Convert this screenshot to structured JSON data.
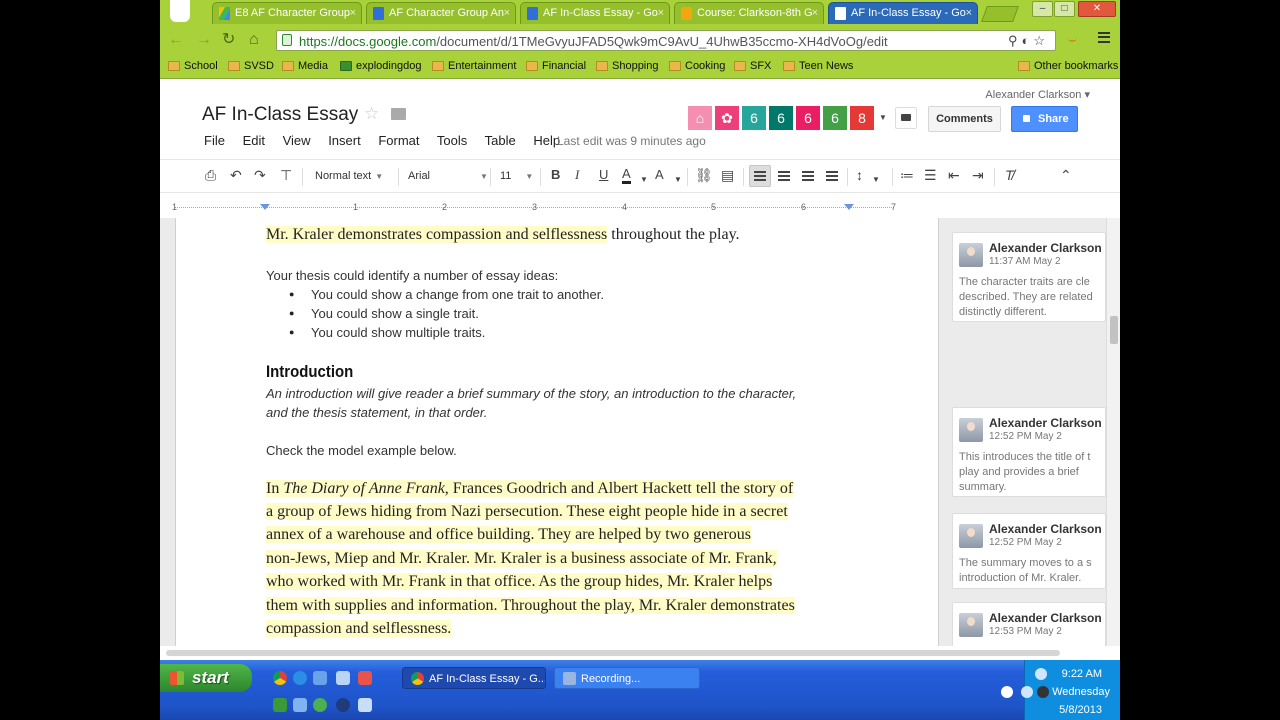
{
  "browser": {
    "tabs": [
      {
        "label": "E8 AF Character Group",
        "icon": "drive"
      },
      {
        "label": "AF Character Group An",
        "icon": "doc"
      },
      {
        "label": "AF In-Class Essay - Go",
        "icon": "doc"
      },
      {
        "label": "Course: Clarkson-8th G",
        "icon": "course"
      },
      {
        "label": "AF In-Class Essay - Go",
        "icon": "doc"
      }
    ],
    "url_host": "https://docs.google.com",
    "url_path": "/document/d/1TMeGvyuJFAD5Qwk9mC9AvU_4UhwB35ccmo-XH4dVoOg/edit",
    "bookmarks": [
      "School",
      "SVSD",
      "Media",
      "explodingdog",
      "Entertainment",
      "Financial",
      "Shopping",
      "Cooking",
      "SFX",
      "Teen News"
    ],
    "other_bookmarks": "Other bookmarks"
  },
  "docs": {
    "title": "AF In-Class Essay",
    "user": "Alexander Clarkson",
    "menu": [
      "File",
      "Edit",
      "View",
      "Insert",
      "Format",
      "Tools",
      "Table",
      "Help"
    ],
    "last_edit": "Last edit was 9 minutes ago",
    "collaborators": [
      {
        "label": "",
        "color": "#f48fb1"
      },
      {
        "label": "",
        "color": "#ec407a"
      },
      {
        "label": "6",
        "color": "#26a69a"
      },
      {
        "label": "6",
        "color": "#00796b"
      },
      {
        "label": "6",
        "color": "#e91e63"
      },
      {
        "label": "6",
        "color": "#43a047"
      },
      {
        "label": "8",
        "color": "#e53935"
      }
    ],
    "comments_button": "Comments",
    "share_button": "Share"
  },
  "toolbar": {
    "style": "Normal text",
    "font": "Arial",
    "size": "11"
  },
  "ruler": [
    "1",
    "1",
    "2",
    "3",
    "4",
    "5",
    "6",
    "7"
  ],
  "document": {
    "line_top": "Mr. Kraler demonstrates compassion and selflessness",
    "line_top_rest": " throughout the play.",
    "thesis_intro": "Your thesis could identify a number of essay ideas:",
    "bullets": [
      "You could show a change from one trait to another.",
      "You could show a single trait.",
      "You could show multiple traits."
    ],
    "heading": "Introduction",
    "intro_lines": [
      "An introduction will give reader a brief summary of the story, an introduction to the character,",
      "and the thesis statement, in that order."
    ],
    "check_model": "Check the model example below.",
    "model_in": "In ",
    "model_book": "The Diary of Anne Frank",
    "model_first_rest": ", Frances Goodrich and Albert Hackett tell the story of",
    "model_lines": [
      "a group of Jews hiding from Nazi persecution.  These eight people hide in a secret",
      "annex of a warehouse and office building.  They are helped by two generous",
      "non-Jews, Miep and Mr. Kraler.  Mr. Kraler is a business associate of Mr. Frank,",
      "who worked with Mr. Frank in that office.  As the group hides, Mr. Kraler helps",
      "them with supplies and information.  Throughout the play, Mr. Kraler demonstrates",
      "compassion and selflessness."
    ]
  },
  "comments": [
    {
      "author": "Alexander Clarkson",
      "time": "11:37 AM May 2",
      "text": "The character traits are cle described. They are related distinctly different."
    },
    {
      "author": "Alexander Clarkson",
      "time": "12:52 PM May 2",
      "text": "This introduces the title of t play and provides a brief summary."
    },
    {
      "author": "Alexander Clarkson",
      "time": "12:52 PM May 2",
      "text": "The summary moves to a s introduction of Mr. Kraler."
    },
    {
      "author": "Alexander Clarkson",
      "time": "12:53 PM May 2",
      "text": ""
    }
  ],
  "taskbar": {
    "start": "start",
    "tasks": [
      "AF In-Class Essay - G...",
      "Recording..."
    ],
    "time": "9:22 AM",
    "day": "Wednesday",
    "date": "5/8/2013"
  }
}
